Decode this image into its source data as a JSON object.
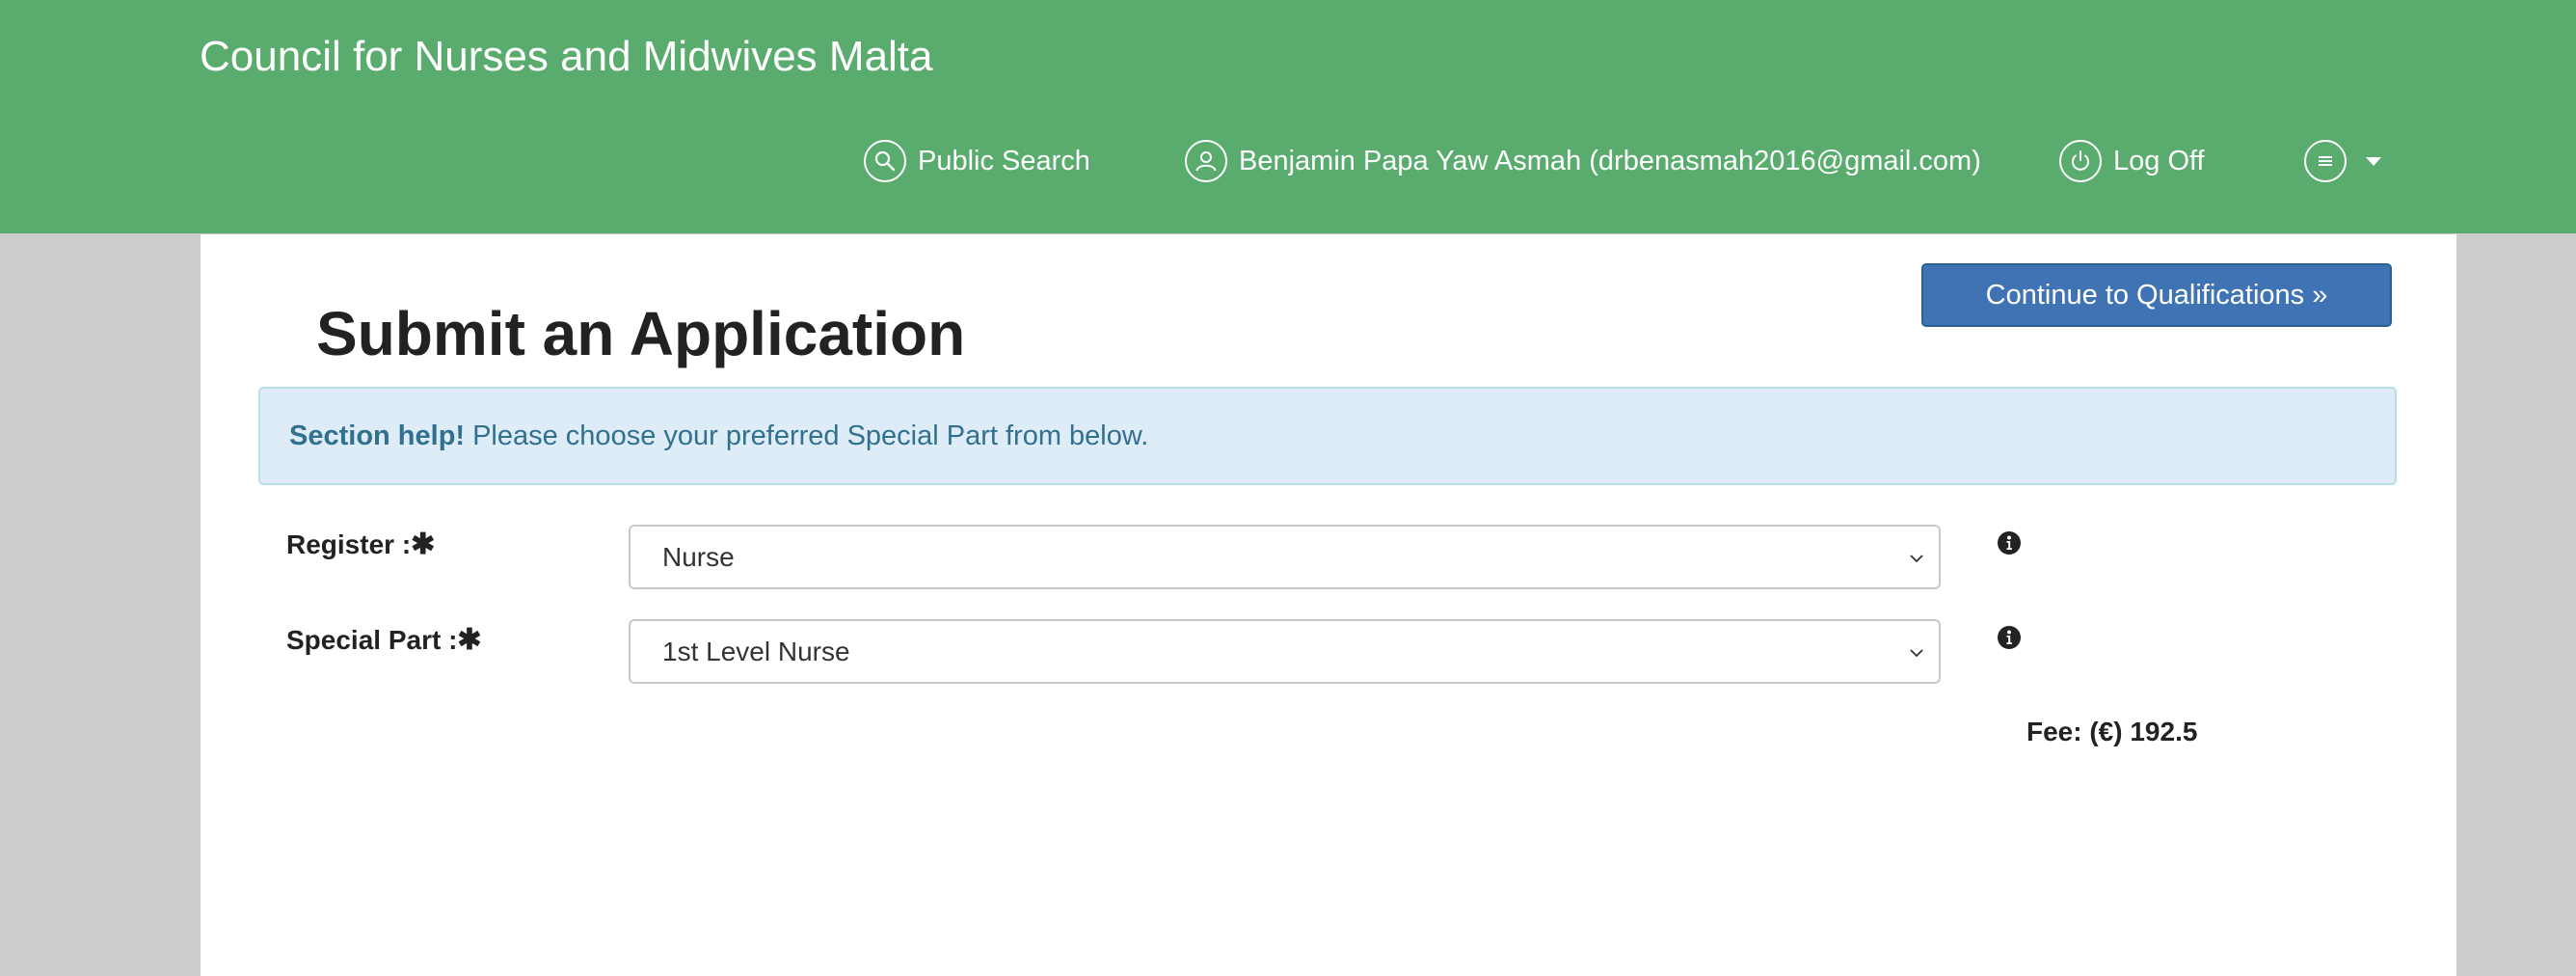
{
  "header": {
    "title": "Council for Nurses and Midwives Malta",
    "nav": {
      "public_search": "Public Search",
      "user": "Benjamin Papa Yaw Asmah  (drbenasmah2016@gmail.com)",
      "log_off": "Log Off"
    },
    "icons": [
      "search-icon",
      "user-icon",
      "power-icon",
      "menu-icon",
      "caret-down-icon"
    ],
    "background_color": "#5aac6e"
  },
  "page": {
    "title": "Submit an Application",
    "continue_button": "Continue to Qualifications »",
    "help": {
      "label": "Section help!",
      "text": "Please choose your preferred Special Part from below."
    },
    "form": {
      "register": {
        "label": "Register :",
        "required_mark": "✱",
        "value": "Nurse"
      },
      "special_part": {
        "label": "Special Part :",
        "required_mark": "✱",
        "value": "1st Level Nurse"
      }
    },
    "fee": "Fee: (€) 192.5"
  },
  "colors": {
    "button_primary": "#3f73b4",
    "alert_background": "#ddecf7",
    "alert_text": "#31708f"
  }
}
